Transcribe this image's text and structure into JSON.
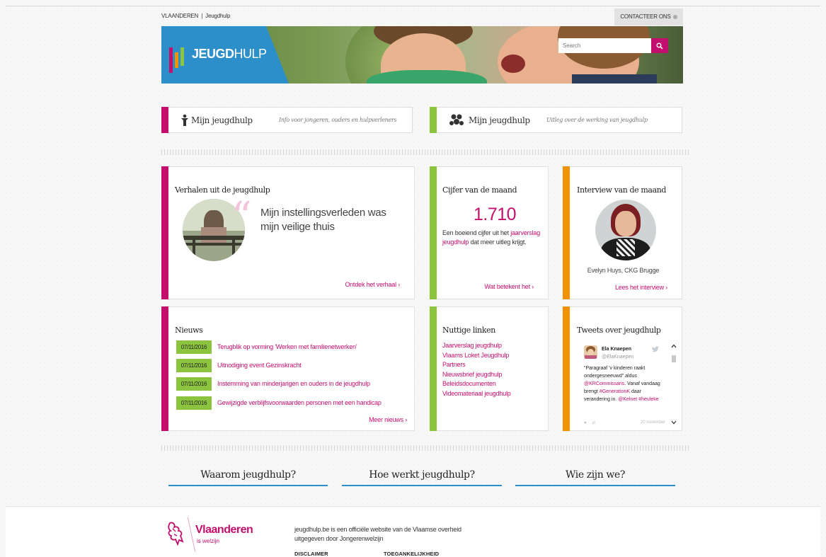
{
  "topbar": {
    "breadcrumb_home": "VLAANDEREN",
    "breadcrumb_sep": "|",
    "breadcrumb_current": "Jeugdhulp",
    "contact_label": "CONTACTEER ONS"
  },
  "banner": {
    "logo_bold": "JEUGD",
    "logo_light": "HULP",
    "search_placeholder": "Search",
    "logo_bar_colors": [
      "#c40e6e",
      "#f39200",
      "#8cc43f",
      "#2c8fc9"
    ]
  },
  "promos": [
    {
      "title": "Mijn jeugdhulp",
      "desc": "Info voor jongeren, ouders en hulpverleners",
      "accent": "#c40e6e",
      "icon": "person-icon"
    },
    {
      "title": "Mijn jeugdhulp",
      "desc": "Uitleg over de werking van jeugdhulp",
      "accent": "#8cc43f",
      "icon": "group-icon"
    }
  ],
  "verhalen": {
    "title": "Verhalen uit de jeugdhulp",
    "quote": "Mijn instellingsverleden was mijn veilige thuis",
    "link": "Ontdek het verhaal ›"
  },
  "cijfer": {
    "title": "Cijfer van de maand",
    "number": "1.710",
    "text_before": "Een boeiend cijfer uit het",
    "link_text": "jaarverslag jeugdhulp",
    "text_after": "dat meer uitleg krijgt.",
    "link": "Wat betekent het ›"
  },
  "interview": {
    "title": "Interview van de maand",
    "caption": "Evelyn Huys, CKG Brugge",
    "link": "Lees het interview ›"
  },
  "nieuws": {
    "title": "Nieuws",
    "items": [
      {
        "date": "07/11/2016",
        "text": "Terugblik op vorming 'Werken met familienetwerken'"
      },
      {
        "date": "07/11/2016",
        "text": "Uitnodiging event Gezinskracht"
      },
      {
        "date": "07/11/2016",
        "text": "Instemming van minderjarigen en ouders in de jeugdhulp"
      },
      {
        "date": "07/11/2016",
        "text": "Gewijzigde verblijfsvoorwaarden personen met een handicap"
      }
    ],
    "more": "Meer nieuws ›"
  },
  "links": {
    "title": "Nuttige linken",
    "items": [
      "Jaarverslag jeugdhulp",
      "Vlaams Loket Jeugdhulp",
      "Partners",
      "Nieuwsbrief jeugdhulp",
      "Beleidsdocumenten",
      "Videomateriaal jeugdhulp"
    ]
  },
  "tweets": {
    "title": "Tweets over jeugdhulp",
    "name": "Ela Knaepen",
    "handle": "@ElaKnaepen",
    "body_1": "\"Paragraaf 'v kinderen raakt ondergesneeuwd\" aldus",
    "mention": "@KRCommissaris",
    "body_2": ". Vanaf vandaag brengt",
    "hashtag1": "#GenerationK",
    "body_3": "daar verandering in.",
    "mention2": "@Kelnet",
    "hashtag2": "#heuleke",
    "date": "20 november"
  },
  "bottom_links": [
    "Waarom jeugdhulp?",
    "Hoe werkt jeugdhulp?",
    "Wie zijn we?"
  ],
  "footer": {
    "brand": "Vlaanderen",
    "brand_sub": "is welzijn",
    "info": "jeugdhulp.be is een officiële website van de Vlaamse overheid uitgegeven door Jongerenwelzijn",
    "disclaimer": "DISCLAIMER",
    "accessibility": "TOEGANKELIJKHEID"
  },
  "colors": {
    "magenta": "#c40e6e",
    "green": "#8cc43f",
    "orange": "#f39200",
    "blue": "#2c8fc9"
  }
}
